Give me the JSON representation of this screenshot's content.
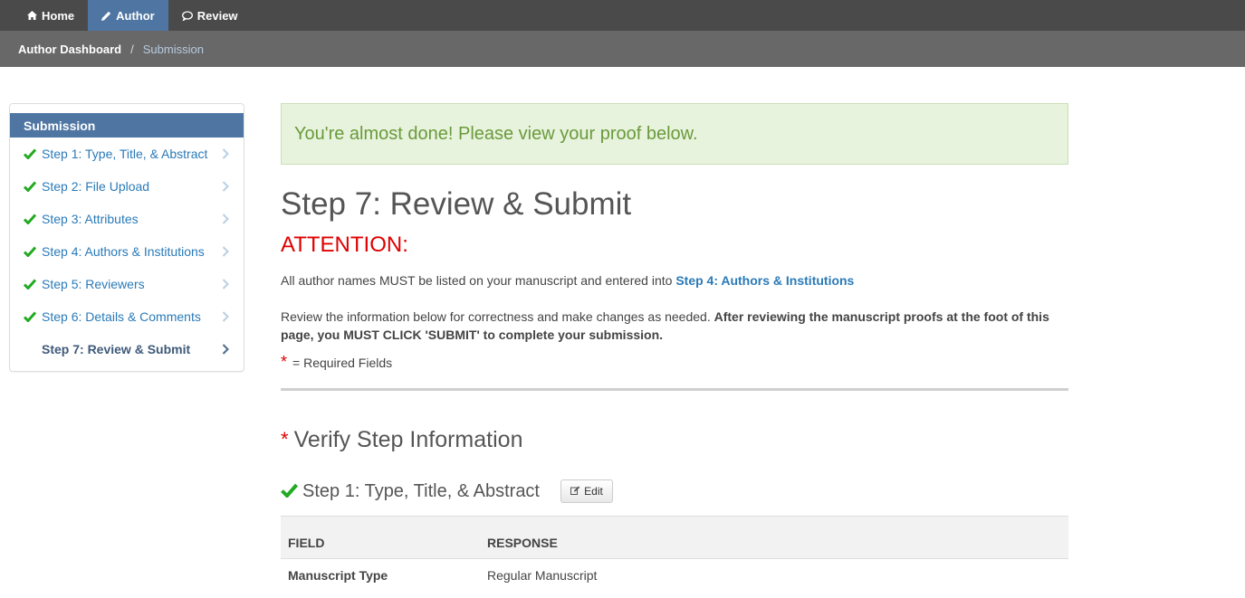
{
  "topnav": {
    "items": [
      {
        "label": "Home",
        "icon": "home-icon"
      },
      {
        "label": "Author",
        "icon": "pencil-icon",
        "active": true
      },
      {
        "label": "Review",
        "icon": "comment-icon"
      }
    ]
  },
  "breadcrumb": {
    "home": "Author Dashboard",
    "separator": "/",
    "current": "Submission"
  },
  "sidebar": {
    "header": "Submission",
    "items": [
      {
        "label": "Step 1: Type, Title, & Abstract",
        "complete": true
      },
      {
        "label": "Step 2: File Upload",
        "complete": true
      },
      {
        "label": "Step 3: Attributes",
        "complete": true
      },
      {
        "label": "Step 4: Authors & Institutions",
        "complete": true
      },
      {
        "label": "Step 5: Reviewers",
        "complete": true
      },
      {
        "label": "Step 6: Details & Comments",
        "complete": true
      },
      {
        "label": "Step 7: Review & Submit",
        "complete": false,
        "current": true
      }
    ]
  },
  "main": {
    "alert": "You're almost done! Please view your proof below.",
    "title": "Step 7: Review & Submit",
    "attention": "ATTENTION:",
    "para1_text": "All author names MUST be listed on your manuscript and entered into",
    "para1_link": "Step 4: Authors & Institutions",
    "para2_text": "Review the information below for correctness and make changes as needed.",
    "para2_bold": "After reviewing the manuscript proofs at the foot of this page, you MUST CLICK 'SUBMIT' to complete your submission.",
    "required_star": "*",
    "required_text": "= Required Fields",
    "verify_star": "*",
    "verify_heading": "Verify Step Information",
    "step1_title": "Step 1: Type, Title, & Abstract",
    "edit_label": "Edit",
    "table": {
      "headers": [
        "FIELD",
        "RESPONSE"
      ],
      "rows": [
        {
          "field": "Manuscript Type",
          "response": "Regular Manuscript"
        }
      ]
    }
  },
  "colors": {
    "topnav_bg": "#4a4a4a",
    "active_nav": "#4f76a3",
    "breadcrumb_bg": "#686868",
    "link": "#2a7ab8",
    "check_green": "#22aa22",
    "attention_red": "#e00000",
    "alert_bg": "#e8f3dd"
  }
}
